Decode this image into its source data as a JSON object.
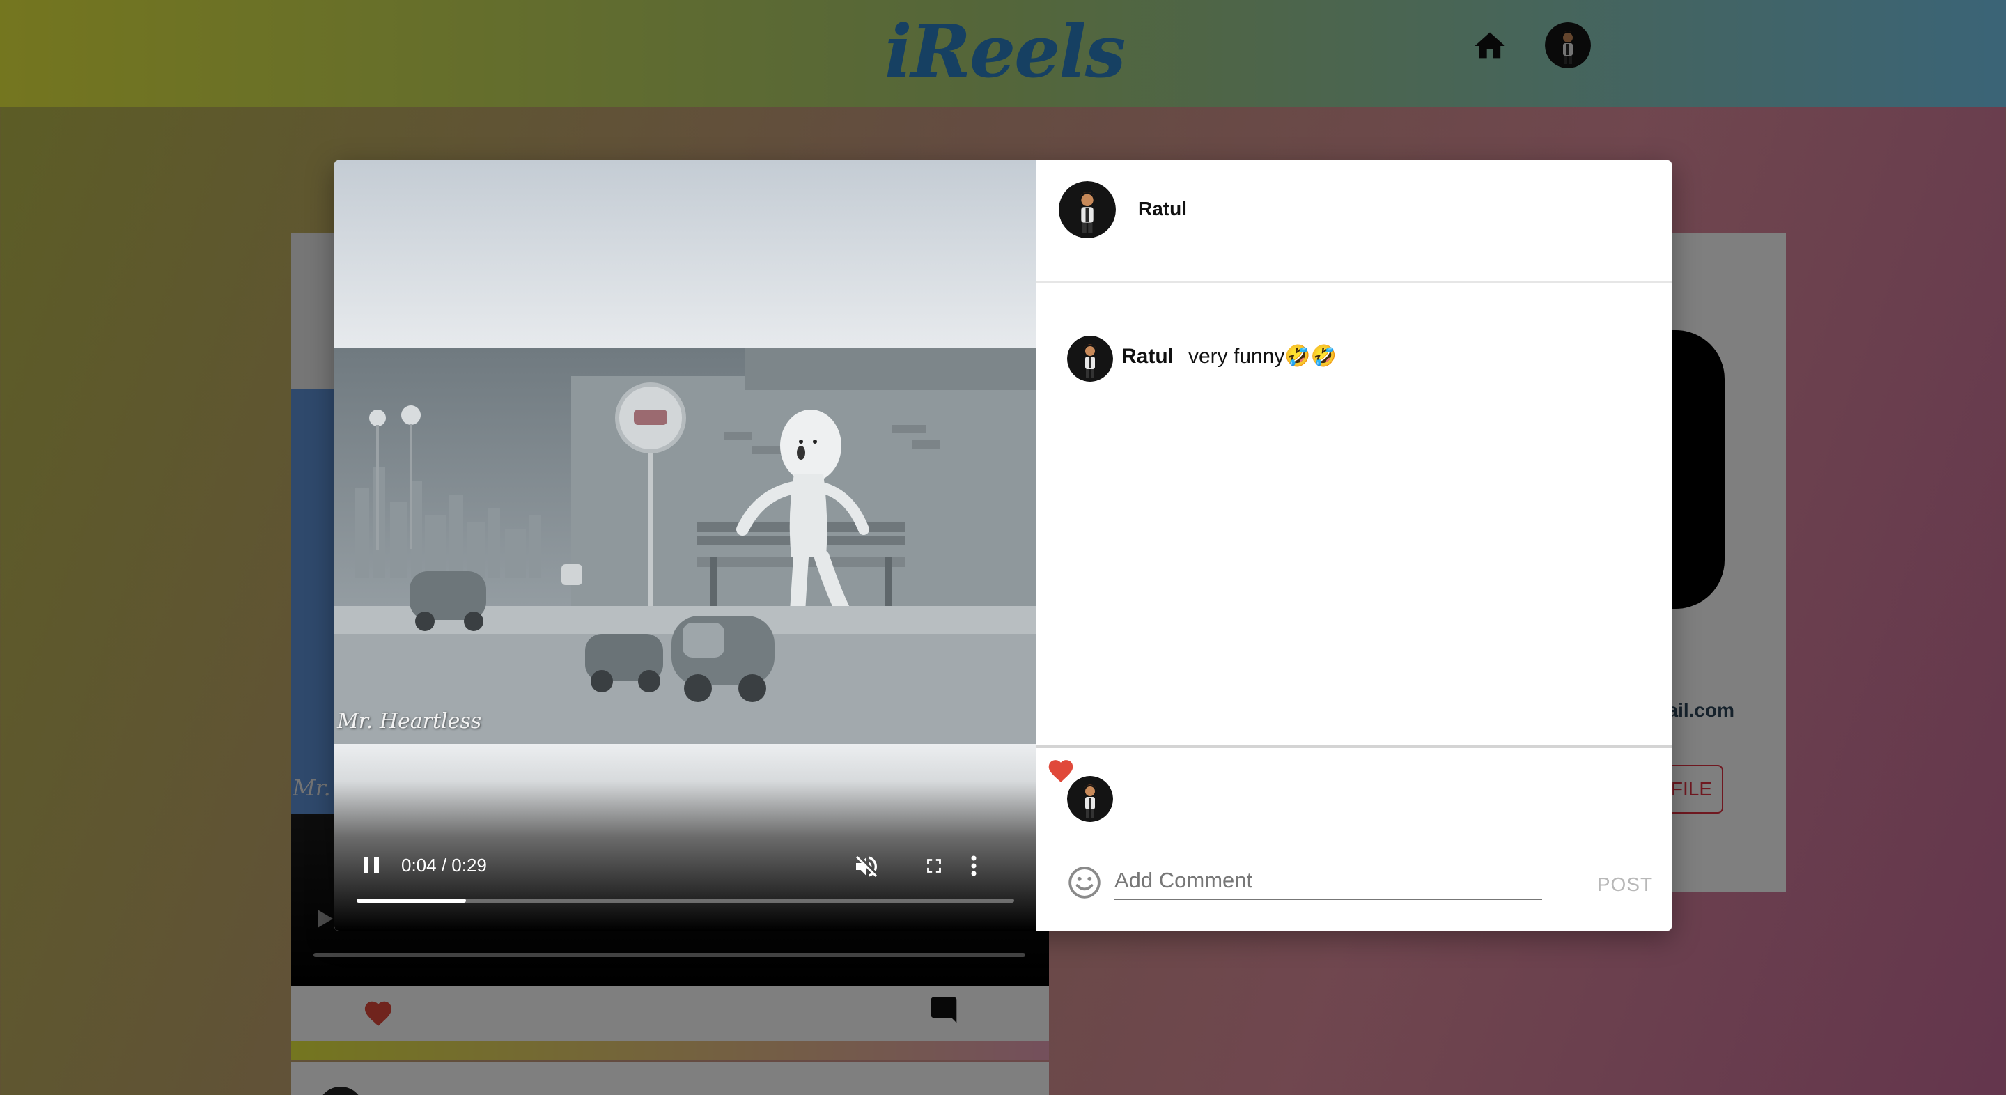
{
  "app": {
    "logo": "iReels"
  },
  "navbar": {
    "home_icon": "home-icon",
    "profile_icon": "avatar"
  },
  "background": {
    "post_watermark": "Mr.",
    "profile_email_fragment": "ail.com",
    "profile_button_fragment": "FILE"
  },
  "modal": {
    "video": {
      "watermark": "Mr. Heartless",
      "time": "0:04 / 0:29",
      "progress_fraction": 0.166,
      "muted": true
    },
    "post_author": "Ratul",
    "comments": [
      {
        "user": "Ratul",
        "text": "very funny🤣🤣"
      }
    ],
    "likes": {
      "liked": true
    },
    "comment_input": {
      "placeholder": "Add Comment",
      "value": ""
    },
    "post_button": "POST"
  },
  "colors": {
    "heart": "#e0493a",
    "logo": "#2c80c4",
    "post_disabled": "#b8b8b8"
  }
}
